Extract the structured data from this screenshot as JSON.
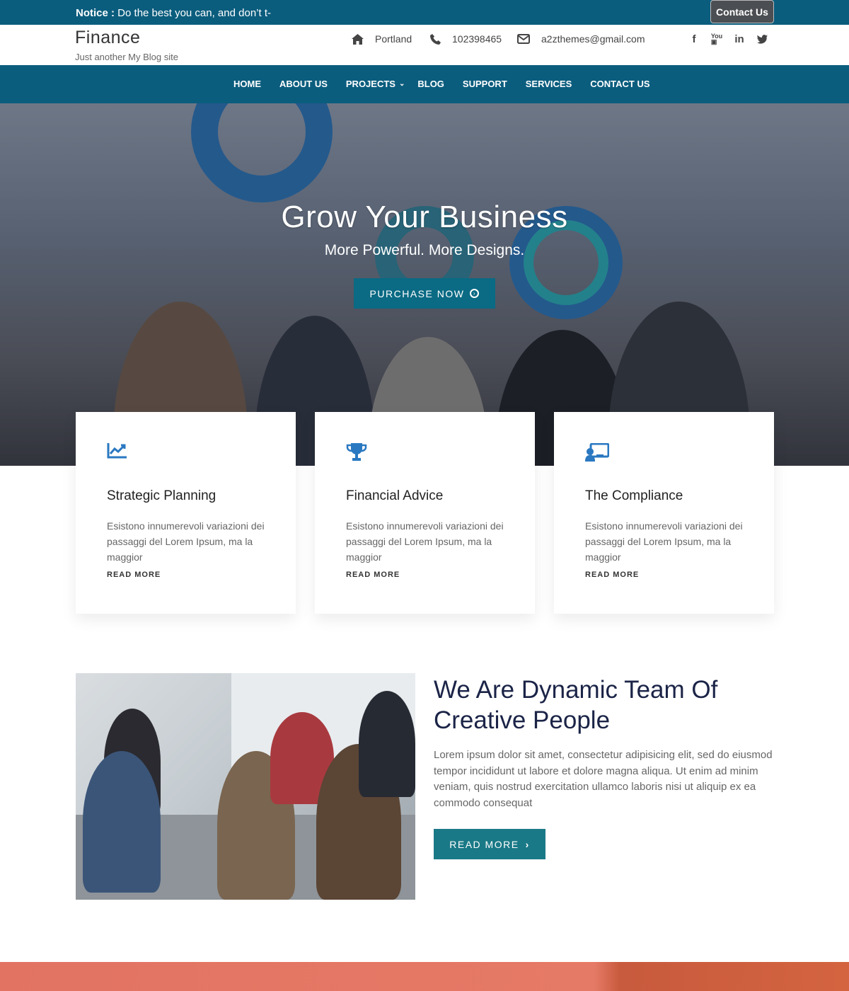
{
  "notice": {
    "label": "Notice :",
    "text": " Do the best you can, and don’t t-",
    "contact_button": "Contact Us"
  },
  "header": {
    "site_title": "Finance",
    "tagline": "Just another My Blog site",
    "location": "Portland",
    "phone": "102398465",
    "email": "a2zthemes@gmail.com",
    "socials": [
      "facebook-icon",
      "youtube-icon",
      "linkedin-icon",
      "twitter-icon"
    ]
  },
  "nav": {
    "items": [
      "HOME",
      "ABOUT US",
      "PROJECTS",
      "BLOG",
      "SUPPORT",
      "SERVICES",
      "CONTACT US"
    ]
  },
  "hero": {
    "title": "Grow Your Business",
    "subtitle": "More Powerful. More Designs.",
    "button": "PURCHASE NOW"
  },
  "cards": [
    {
      "icon": "chart-line-icon",
      "title": "Strategic Planning",
      "desc": "Esistono innumerevoli variazioni dei passaggi del Lorem Ipsum, ma la maggior",
      "more": "READ MORE"
    },
    {
      "icon": "trophy-icon",
      "title": "Financial Advice",
      "desc": "Esistono innumerevoli variazioni dei passaggi del Lorem Ipsum, ma la maggior",
      "more": "READ MORE"
    },
    {
      "icon": "presenter-icon",
      "title": "The Compliance",
      "desc": "Esistono innumerevoli variazioni dei passaggi del Lorem Ipsum, ma la maggior",
      "more": "READ MORE"
    }
  ],
  "about": {
    "title": "We Are Dynamic Team Of Creative People",
    "text": "Lorem ipsum dolor sit amet, consectetur adipisicing elit, sed do eiusmod tempor incididunt ut labore et dolore magna aliqua. Ut enim ad minim veniam, quis nostrud exercitation ullamco laboris nisi ut aliquip ex ea commodo consequat",
    "button": "READ MORE"
  },
  "colors": {
    "primary": "#0b5d7e",
    "button": "#0b6a84",
    "heading": "#1b2447",
    "icon": "#2a78c1"
  }
}
